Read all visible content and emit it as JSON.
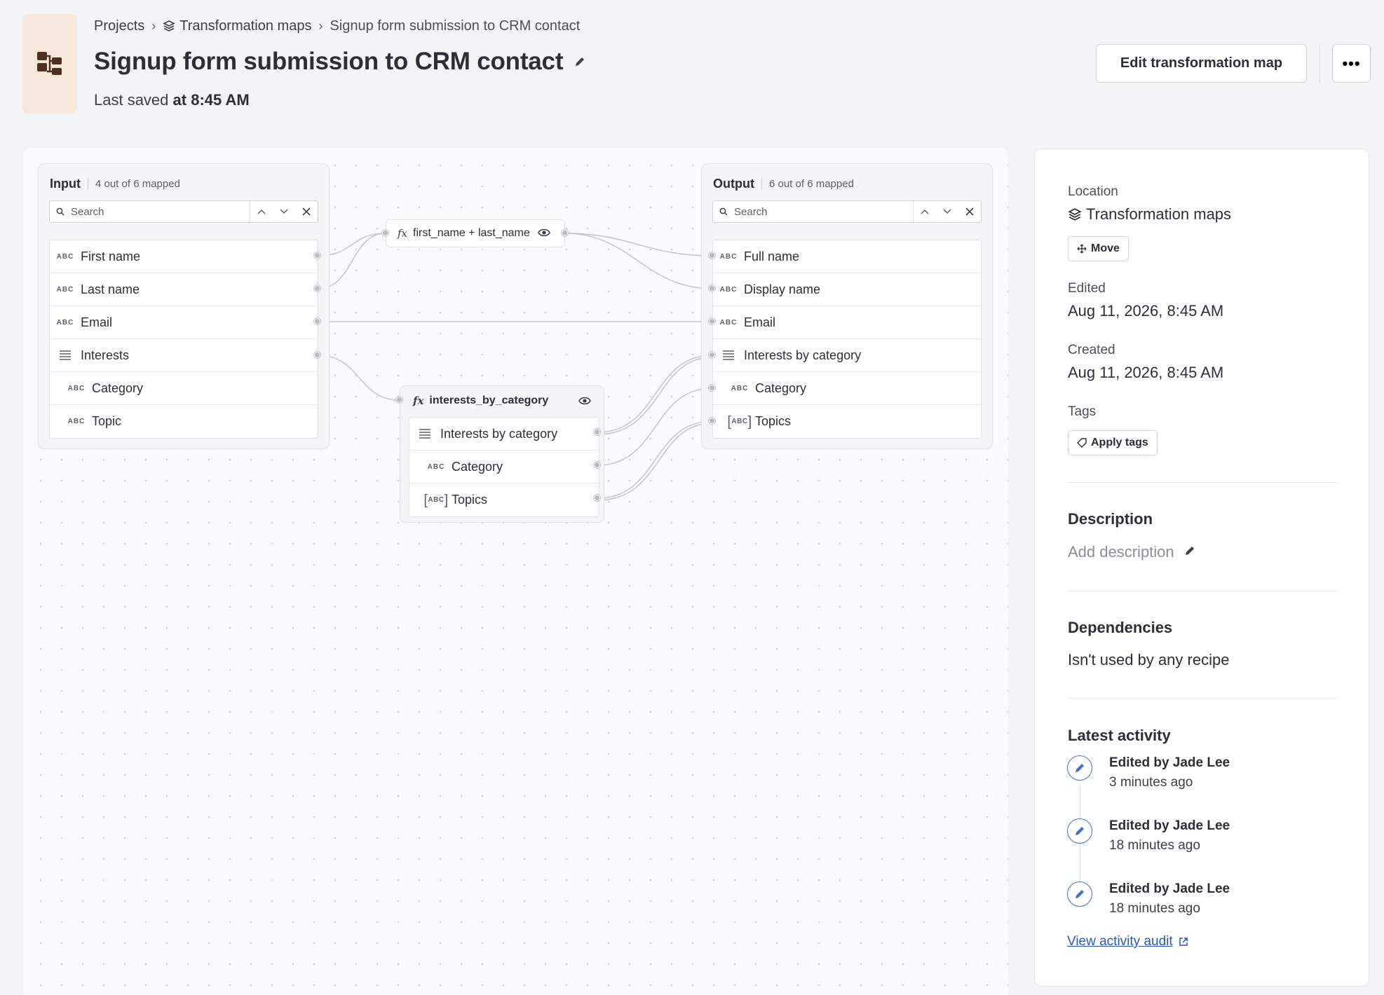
{
  "breadcrumb": {
    "projects": "Projects",
    "folder": "Transformation maps",
    "current": "Signup form submission to CRM contact"
  },
  "title": "Signup form submission to CRM contact",
  "last_saved": {
    "prefix": "Last saved",
    "time": "at 8:45 AM"
  },
  "actions": {
    "edit": "Edit transformation map",
    "more": "•••"
  },
  "input_panel": {
    "title": "Input",
    "count": "4 out of 6 mapped",
    "search_placeholder": "Search",
    "fields": [
      {
        "label": "First name",
        "type": "ABC"
      },
      {
        "label": "Last name",
        "type": "ABC"
      },
      {
        "label": "Email",
        "type": "ABC"
      },
      {
        "label": "Interests",
        "type": "list"
      },
      {
        "label": "Category",
        "type": "ABC"
      },
      {
        "label": "Topic",
        "type": "ABC"
      }
    ]
  },
  "output_panel": {
    "title": "Output",
    "count": "6 out of 6 mapped",
    "search_placeholder": "Search",
    "fields": [
      {
        "label": "Full name",
        "type": "ABC"
      },
      {
        "label": "Display name",
        "type": "ABC"
      },
      {
        "label": "Email",
        "type": "ABC"
      },
      {
        "label": "Interests by category",
        "type": "list"
      },
      {
        "label": "Category",
        "type": "ABC"
      },
      {
        "label": "Topics",
        "type": "ABC"
      }
    ]
  },
  "formula_node": {
    "fx": "fx",
    "expression": "first_name + last_name"
  },
  "function_group": {
    "fx": "fx",
    "name": "interests_by_category",
    "fields": [
      {
        "label": "Interests by category",
        "type": "list"
      },
      {
        "label": "Category",
        "type": "ABC"
      },
      {
        "label": "Topics",
        "type": "ABC"
      }
    ]
  },
  "type_label": "ABC",
  "sidebar": {
    "location_label": "Location",
    "location_value": "Transformation maps",
    "move_button": "Move",
    "edited_label": "Edited",
    "edited_value": "Aug 11, 2026, 8:45 AM",
    "created_label": "Created",
    "created_value": "Aug 11, 2026, 8:45 AM",
    "tags_label": "Tags",
    "apply_tags_button": "Apply tags",
    "description_heading": "Description",
    "description_placeholder": "Add description",
    "dependencies_heading": "Dependencies",
    "dependencies_value": "Isn't used by any recipe",
    "activity_heading": "Latest activity",
    "activity": [
      {
        "who": "Edited by Jade Lee",
        "when": "3 minutes ago"
      },
      {
        "who": "Edited by Jade Lee",
        "when": "18 minutes ago"
      },
      {
        "who": "Edited by Jade Lee",
        "when": "18 minutes ago"
      }
    ],
    "audit_link": "View activity audit"
  },
  "colors": {
    "accent": "#2757c4",
    "icon_tile": "#f5e7dc",
    "icon_brown": "#4a2f24"
  }
}
